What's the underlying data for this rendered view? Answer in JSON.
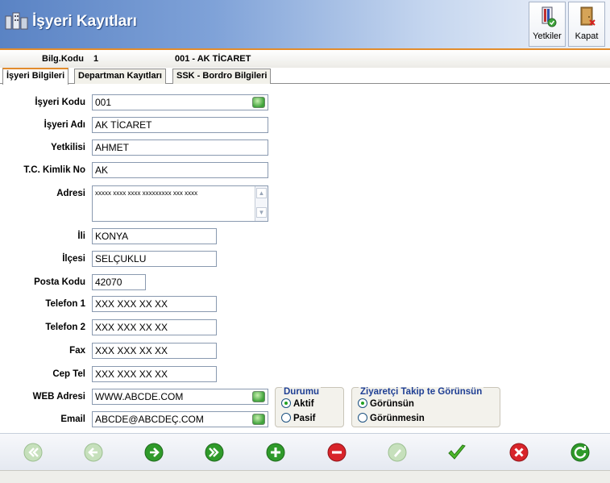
{
  "window": {
    "title": "İşyeri Kayıtları"
  },
  "toolbar": {
    "yetkiler_label": "Yetkiler",
    "kapat_label": "Kapat"
  },
  "info": {
    "bilg_label": "Bilg.Kodu",
    "bilg_value": "1",
    "firm": "001 - AK TİCARET"
  },
  "tabs": [
    {
      "label": "İşyeri Bilgileri",
      "active": true
    },
    {
      "label": "Departman Kayıtları",
      "active": false
    },
    {
      "label": "SSK - Bordro  Bilgileri",
      "active": false
    }
  ],
  "form": {
    "isyeri_kodu": {
      "label": "İşyeri Kodu",
      "value": "001"
    },
    "isyeri_adi": {
      "label": "İşyeri Adı",
      "value": "AK TİCARET"
    },
    "yetkilisi": {
      "label": "Yetkilisi",
      "value": "AHMET"
    },
    "tc": {
      "label": "T.C. Kimlik No",
      "value": "AK"
    },
    "adres": {
      "label": "Adresi",
      "value": "xxxxx xxxx xxxx xxxxxxxxx xxx xxxx"
    },
    "il": {
      "label": "İli",
      "value": "KONYA"
    },
    "ilce": {
      "label": "İlçesi",
      "value": "SELÇUKLU"
    },
    "posta": {
      "label": "Posta Kodu",
      "value": "42070"
    },
    "tel1": {
      "label": "Telefon 1",
      "value": "XXX XXX XX XX"
    },
    "tel2": {
      "label": "Telefon 2",
      "value": "XXX XXX XX XX"
    },
    "fax": {
      "label": "Fax",
      "value": "XXX XXX XX XX"
    },
    "cep": {
      "label": "Cep Tel",
      "value": "XXX XXX XX XX"
    },
    "web": {
      "label": "WEB Adresi",
      "value": "WWW.ABCDE.COM"
    },
    "email": {
      "label": "Email",
      "value": "ABCDE@ABCDEÇ.COM"
    }
  },
  "durumu": {
    "title": "Durumu",
    "options": [
      "Aktif",
      "Pasif"
    ],
    "selected": "Aktif"
  },
  "ziyaretci": {
    "title": "Ziyaretçi Takip te Görünsün",
    "options": [
      "Görünsün",
      "Görünmesin"
    ],
    "selected": "Görünsün"
  },
  "colors": {
    "accent_orange": "#e28c2c",
    "title_blue": "#5a83c4",
    "group_title": "#1f3f94"
  },
  "nav_icons": [
    "first-icon",
    "previous-icon",
    "next-icon",
    "last-icon",
    "add-icon",
    "delete-icon",
    "edit-icon",
    "save-icon",
    "cancel-icon",
    "refresh-icon"
  ]
}
